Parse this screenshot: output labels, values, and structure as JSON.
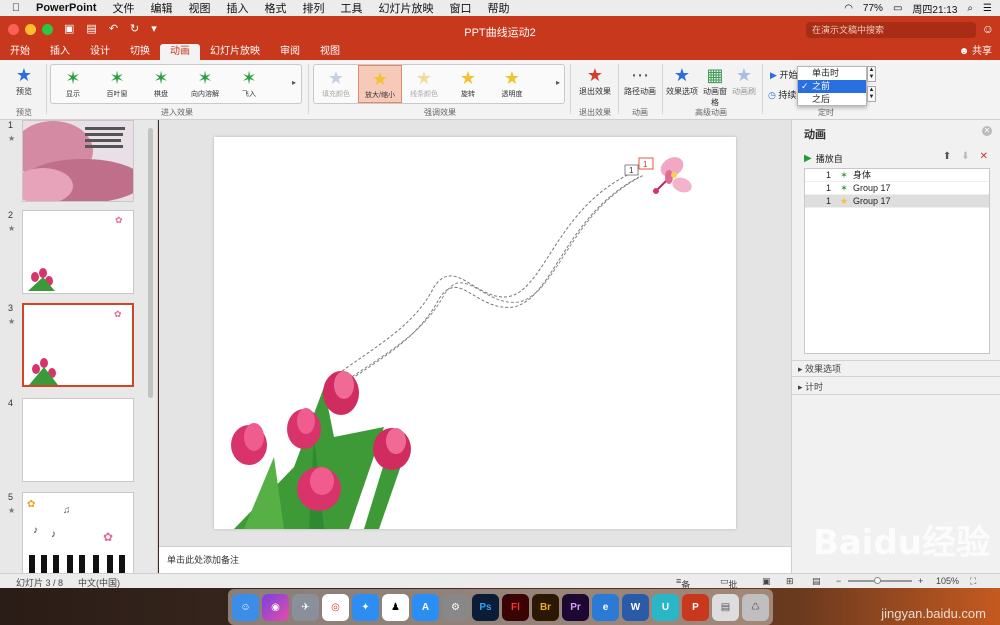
{
  "menubar": {
    "app": "PowerPoint",
    "items": [
      "文件",
      "编辑",
      "视图",
      "插入",
      "格式",
      "排列",
      "工具",
      "幻灯片放映",
      "窗口",
      "帮助"
    ],
    "battery": "77%",
    "clock": "周四21:13"
  },
  "window": {
    "title": "PPT曲线运动2",
    "search_placeholder": "在演示文稿中搜索",
    "share": "共享"
  },
  "tabs": [
    "开始",
    "插入",
    "设计",
    "切换",
    "动画",
    "幻灯片放映",
    "审阅",
    "视图"
  ],
  "active_tab": "动画",
  "ribbon": {
    "preview": "预览",
    "preview_group": "预览",
    "entrance_group": "进入效果",
    "entrance": [
      "显示",
      "百叶窗",
      "棋盘",
      "向内溶解",
      "飞入"
    ],
    "emphasis_group": "强调效果",
    "emphasis": [
      "填充颜色",
      "放大/缩小",
      "线条颜色",
      "旋转",
      "透明度"
    ],
    "exit_group": "退出效果",
    "exit_btn": "退出效果",
    "anim_group": "动画",
    "path_btn": "路径动画",
    "adv_group": "高级动画",
    "effect_opts": "效果选项",
    "anim_pane_btn": "动画窗格",
    "anim_brush": "动画刷",
    "timing_group": "定时",
    "start_label": "开始",
    "duration_label": "持续"
  },
  "start_dropdown": {
    "options": [
      "单击时",
      "之前",
      "之后"
    ],
    "selected": "之前"
  },
  "slides": [
    {
      "num": "1"
    },
    {
      "num": "2"
    },
    {
      "num": "3"
    },
    {
      "num": "4"
    },
    {
      "num": "5"
    }
  ],
  "current_slide": "3",
  "slide_tag": "1",
  "notes_placeholder": "单击此处添加备注",
  "anim_pane": {
    "title": "动画",
    "play_from": "播放自",
    "items": [
      {
        "order": "1",
        "name": "身体"
      },
      {
        "order": "1",
        "name": "Group 17"
      },
      {
        "order": "1",
        "name": "Group 17"
      }
    ],
    "effect_options": "效果选项",
    "timing": "计时"
  },
  "status": {
    "slide_info": "幻灯片 3 / 8",
    "language": "中文(中国)",
    "notes": "备注",
    "comments": "批注",
    "zoom": "105%"
  },
  "dock": [
    "Finder",
    "Siri",
    "Launchpad",
    "Chrome",
    "Safari",
    "QQ",
    "App Store",
    "Prefs",
    "Ps",
    "Fl",
    "Br",
    "Pr",
    "Edge",
    "W",
    "U",
    "P",
    "Preview",
    "Trash"
  ],
  "watermark": "Baidu经验",
  "watermark_url": "jingyan.baidu.com",
  "colors": {
    "accent": "#c8381c",
    "selection": "#2a6fe0",
    "play": "#1aa033"
  }
}
